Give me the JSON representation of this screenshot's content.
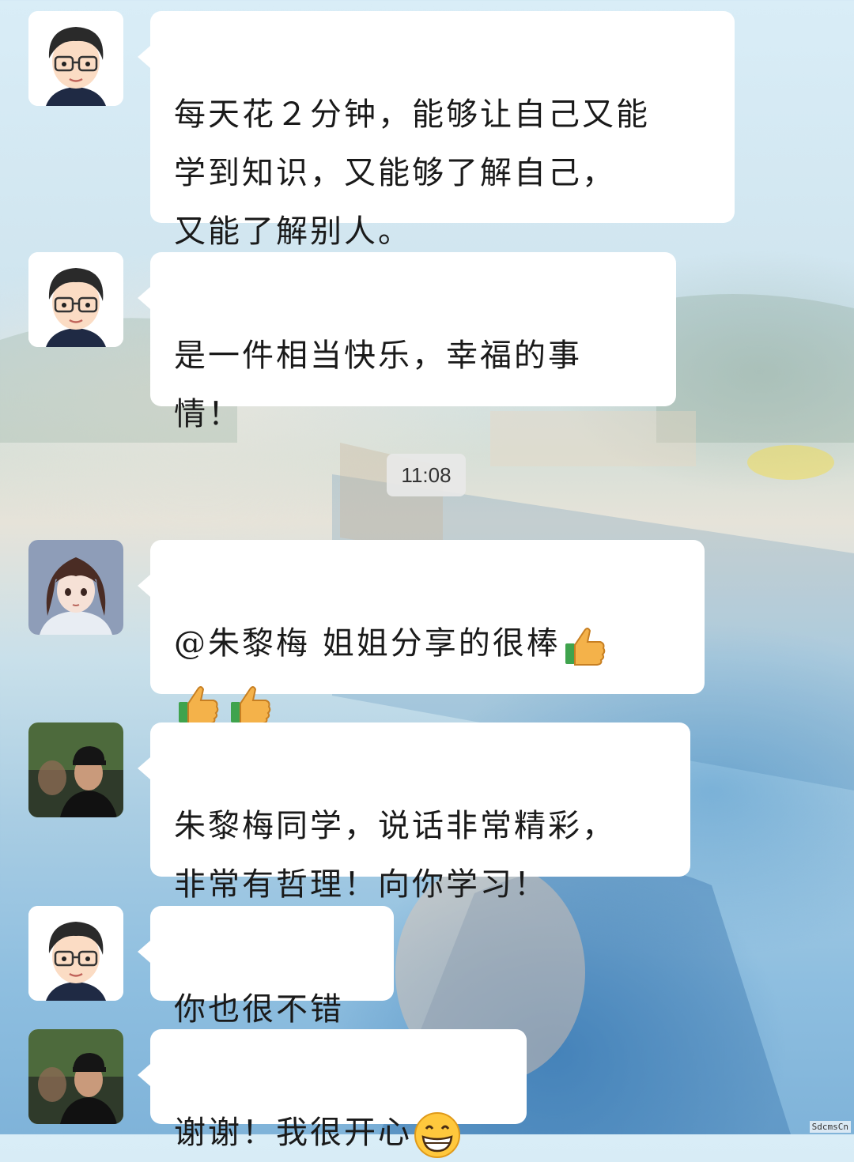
{
  "timestamp": "11:08",
  "watermark": "SdcmsCn",
  "messages": [
    {
      "sender_avatar": "cartoon-boy-glasses-avatar",
      "text": "每天花２分钟，能够让自己又能\n学到知识，又能够了解自己，\n又能了解别人。"
    },
    {
      "sender_avatar": "cartoon-boy-glasses-avatar",
      "text": "是一件相当快乐，幸福的事\n情！"
    },
    {
      "sender_avatar": "anime-girl-avatar",
      "text": "@朱黎梅  姐姐分享的很棒",
      "emojis": [
        "thumbs-up-icon",
        "thumbs-up-icon",
        "thumbs-up-icon"
      ]
    },
    {
      "sender_avatar": "photo-young-man-avatar",
      "text": "朱黎梅同学，说话非常精彩，\n非常有哲理！向你学习！"
    },
    {
      "sender_avatar": "cartoon-boy-glasses-avatar",
      "text": "你也很不错"
    },
    {
      "sender_avatar": "photo-young-man-avatar",
      "text": "谢谢！我很开心",
      "emojis": [
        "grinning-face-icon"
      ]
    }
  ],
  "colors": {
    "bubble": "#ffffff",
    "text": "#1a1a1a",
    "timestamp_bg": "#e8e8e8",
    "thumb": "#f4b24a",
    "sleeve": "#3fa34d",
    "emoji_face": "#ffc83d"
  }
}
